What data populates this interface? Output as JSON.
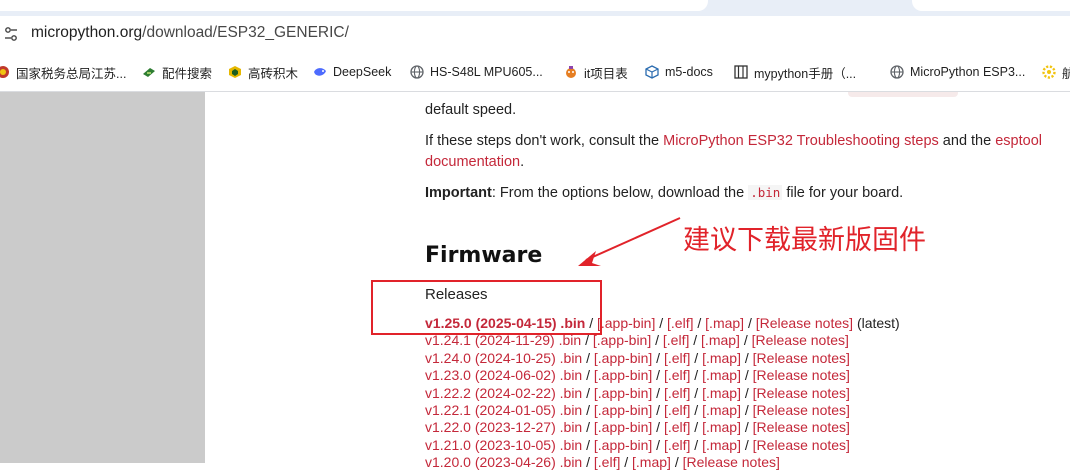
{
  "browser": {
    "url_host": "micropython.org",
    "url_path": "/download/ESP32_GENERIC/"
  },
  "bookmarks": [
    {
      "label": "国家税务总局江苏...",
      "icon": "tax-bureau-icon",
      "color": "#c0392b"
    },
    {
      "label": "配件搜索",
      "icon": "parts-search-icon",
      "color": "#2e7d32"
    },
    {
      "label": "高砖积木",
      "icon": "bricks-icon",
      "color": "#e6b800"
    },
    {
      "label": "DeepSeek",
      "icon": "deepseek-icon",
      "color": "#4d6bfe"
    },
    {
      "label": "HS-S48L MPU605...",
      "icon": "globe-icon",
      "color": "#5f6368"
    },
    {
      "label": "it项目表",
      "icon": "project-icon",
      "color": "#e67e22"
    },
    {
      "label": "m5-docs",
      "icon": "cube-icon",
      "color": "#2b6cb0"
    },
    {
      "label": "mypython手册（...",
      "icon": "book-icon",
      "color": "#333333"
    },
    {
      "label": "MicroPython ESP3...",
      "icon": "globe-icon",
      "color": "#5f6368"
    },
    {
      "label": "航",
      "icon": "gear-icon",
      "color": "#f1c40f"
    }
  ],
  "page": {
    "line_top": "default speed.",
    "troubleshoot": {
      "prefix": "If these steps don't work, consult the ",
      "link1": "MicroPython ESP32 Troubleshooting steps",
      "middle": " and the ",
      "link2_a": "esptool",
      "link2_b": "documentation",
      "suffix": "."
    },
    "important": {
      "bold": "Important",
      "text_a": ": From the options below, download the ",
      "code": ".bin",
      "text_b": " file for your board."
    },
    "firmware_heading": "Firmware",
    "releases_label": "Releases",
    "releases": [
      {
        "main": "v1.25.0 (2025-04-15) .bin",
        "app_bin": "[.app-bin]",
        "elf": "[.elf]",
        "map": "[.map]",
        "notes": "[Release notes]",
        "tag": "(latest)"
      },
      {
        "main": "v1.24.1 (2024-11-29) .bin",
        "app_bin": "[.app-bin]",
        "elf": "[.elf]",
        "map": "[.map]",
        "notes": "[Release notes]",
        "tag": ""
      },
      {
        "main": "v1.24.0 (2024-10-25) .bin",
        "app_bin": "[.app-bin]",
        "elf": "[.elf]",
        "map": "[.map]",
        "notes": "[Release notes]",
        "tag": ""
      },
      {
        "main": "v1.23.0 (2024-06-02) .bin",
        "app_bin": "[.app-bin]",
        "elf": "[.elf]",
        "map": "[.map]",
        "notes": "[Release notes]",
        "tag": ""
      },
      {
        "main": "v1.22.2 (2024-02-22) .bin",
        "app_bin": "[.app-bin]",
        "elf": "[.elf]",
        "map": "[.map]",
        "notes": "[Release notes]",
        "tag": ""
      },
      {
        "main": "v1.22.1 (2024-01-05) .bin",
        "app_bin": "[.app-bin]",
        "elf": "[.elf]",
        "map": "[.map]",
        "notes": "[Release notes]",
        "tag": ""
      },
      {
        "main": "v1.22.0 (2023-12-27) .bin",
        "app_bin": "[.app-bin]",
        "elf": "[.elf]",
        "map": "[.map]",
        "notes": "[Release notes]",
        "tag": ""
      },
      {
        "main": "v1.21.0 (2023-10-05) .bin",
        "app_bin": "[.app-bin]",
        "elf": "[.elf]",
        "map": "[.map]",
        "notes": "[Release notes]",
        "tag": ""
      },
      {
        "main": "v1.20.0 (2023-04-26) .bin",
        "app_bin": "",
        "elf": "[.elf]",
        "map": "[.map]",
        "notes": "[Release notes]",
        "tag": ""
      }
    ]
  },
  "annotation": {
    "text": "建议下载最新版固件",
    "color": "#e1232a"
  },
  "colors": {
    "link": "#c4283a",
    "side_panel": "#cbcbcb"
  }
}
